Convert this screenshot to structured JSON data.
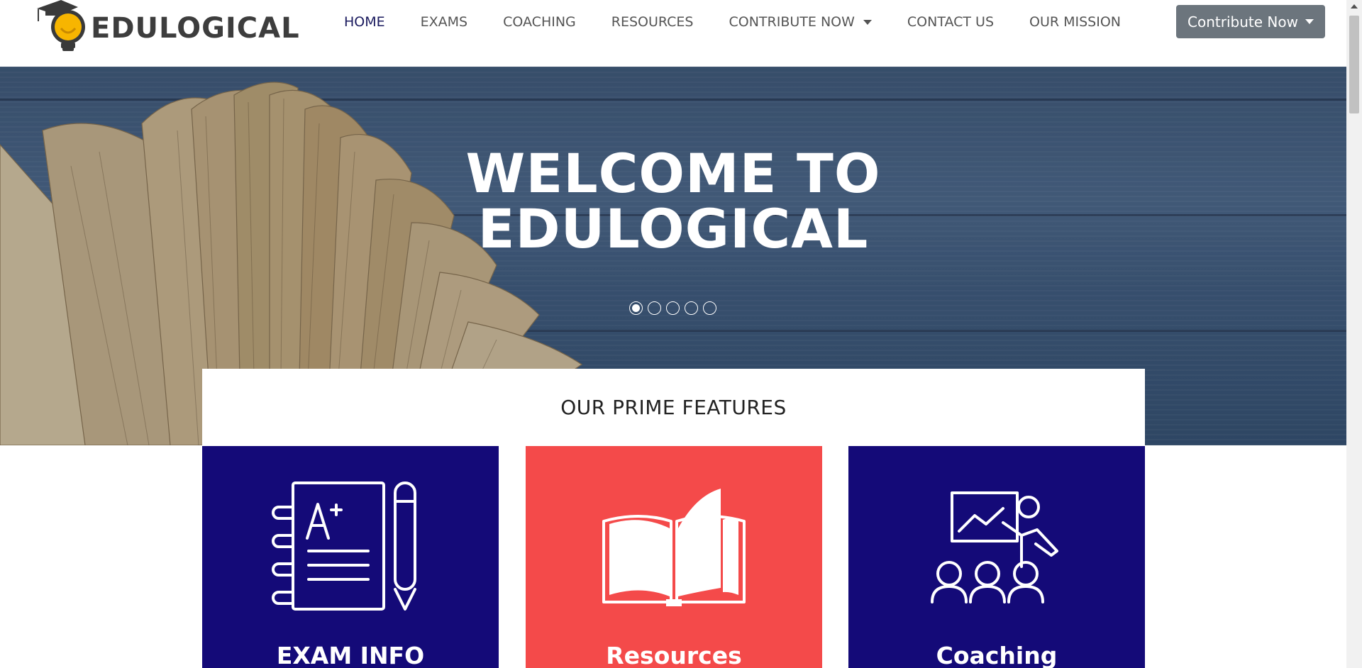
{
  "brand": {
    "name": "EDULOGICAL"
  },
  "nav": {
    "items": [
      {
        "label": "HOME",
        "active": true
      },
      {
        "label": "EXAMS"
      },
      {
        "label": "COACHING"
      },
      {
        "label": "RESOURCES"
      },
      {
        "label": "CONTRIBUTE NOW",
        "dropdown": true
      },
      {
        "label": "CONTACT US"
      },
      {
        "label": "OUR MISSION"
      }
    ],
    "contribute_button": "Contribute Now"
  },
  "hero": {
    "title_line1": "WELCOME TO",
    "title_line2": "EDULOGICAL",
    "slides_total": 5,
    "active_slide": 1
  },
  "features": {
    "title": "OUR PRIME FEATURES",
    "cards": [
      {
        "title": "EXAM INFO",
        "icon": "notebook-pencil-icon",
        "color": "#140a78"
      },
      {
        "title": "Resources",
        "icon": "open-book-icon",
        "color": "#f44a4a"
      },
      {
        "title": "Coaching",
        "icon": "teacher-presentation-icon",
        "color": "#140a78"
      }
    ]
  },
  "colors": {
    "navy": "#140a78",
    "red": "#f44a4a",
    "button_gray": "#6c757d",
    "logo_yellow": "#f7b500"
  }
}
